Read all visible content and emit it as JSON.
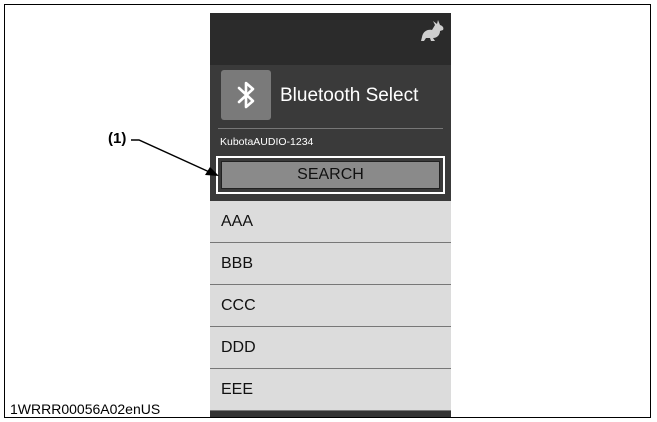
{
  "app": {
    "title": "Bluetooth Select",
    "device_name": "KubotaAUDIO-1234",
    "search_label": "SEARCH",
    "icons": {
      "top_right": "rabbit-icon",
      "tile": "bluetooth-icon"
    }
  },
  "list": {
    "items": [
      "AAA",
      "BBB",
      "CCC",
      "DDD",
      "EEE"
    ]
  },
  "callout": {
    "label": "(1)"
  },
  "document": {
    "code": "1WRRR00056A02enUS"
  },
  "colors": {
    "screen_dark": "#2b2b2b",
    "header": "#3a3a3a",
    "list_bg": "#dcdcdc",
    "button": "#8a8a8a"
  }
}
